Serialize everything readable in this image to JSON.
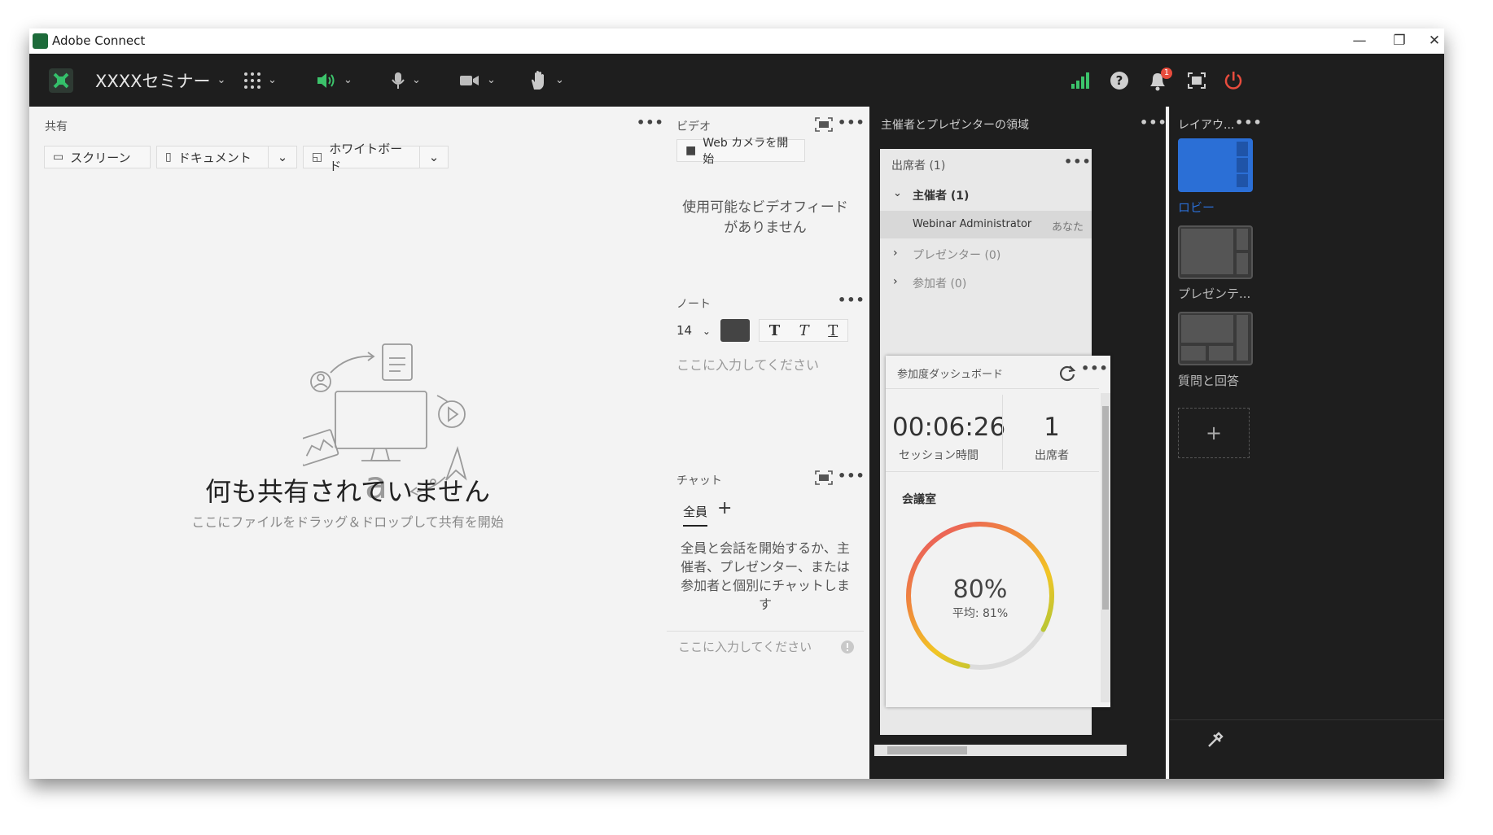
{
  "window": {
    "title": "Adobe Connect",
    "controls": {
      "minimize": "—",
      "restore": "❐",
      "close": "✕"
    }
  },
  "toolbar": {
    "meeting_name": "XXXXセミナー",
    "notification_count": "1"
  },
  "share_pod": {
    "title": "共有",
    "buttons": {
      "screen": "スクリーン",
      "document": "ドキュメント",
      "whiteboard": "ホワイトボード"
    },
    "empty_title": "何も共有されていません",
    "empty_subtitle": "ここにファイルをドラッグ＆ドロップして共有を開始"
  },
  "video_pod": {
    "title": "ビデオ",
    "start_button": "Web カメラを開始",
    "empty_text": "使用可能なビデオフィードがありません"
  },
  "notes_pod": {
    "title": "ノート",
    "font_size": "14",
    "placeholder": "ここに入力してください"
  },
  "chat_pod": {
    "title": "チャット",
    "tab_all": "全員",
    "tab_add": "+",
    "empty_text": "全員と会話を開始するか、主催者、プレゼンター、または参加者と個別にチャットします",
    "input_placeholder": "ここに入力してください"
  },
  "presenter_area": {
    "title": "主催者とプレゼンターの領域"
  },
  "attendees": {
    "header": "出席者 (1)",
    "groups": [
      {
        "label": "主催者 (1)",
        "expanded": true
      },
      {
        "label": "プレゼンター (0)",
        "expanded": false
      },
      {
        "label": "参加者 (0)",
        "expanded": false
      }
    ],
    "host_member": "Webinar Administrator",
    "host_member_you": "あなた"
  },
  "engagement": {
    "title": "参加度ダッシュボード",
    "session_time": "00:06:26",
    "session_time_label": "セッション時間",
    "attendee_count": "1",
    "attendee_label": "出席者",
    "room_label": "会議室",
    "percent": "80%",
    "average": "平均: 81%",
    "gauge_fraction": 0.8
  },
  "layouts": {
    "title": "レイアウ...",
    "items": [
      {
        "label": "ロビー",
        "active": true
      },
      {
        "label": "プレゼンテ...",
        "active": false
      },
      {
        "label": "質問と回答",
        "active": false
      }
    ],
    "add": "+"
  },
  "colors": {
    "toolbar_bg": "#1e1e1e",
    "accent_blue": "#2b6fd6",
    "green_signal": "#4caf50",
    "power_red": "#e84c3d",
    "badge_red": "#e84c3d"
  }
}
